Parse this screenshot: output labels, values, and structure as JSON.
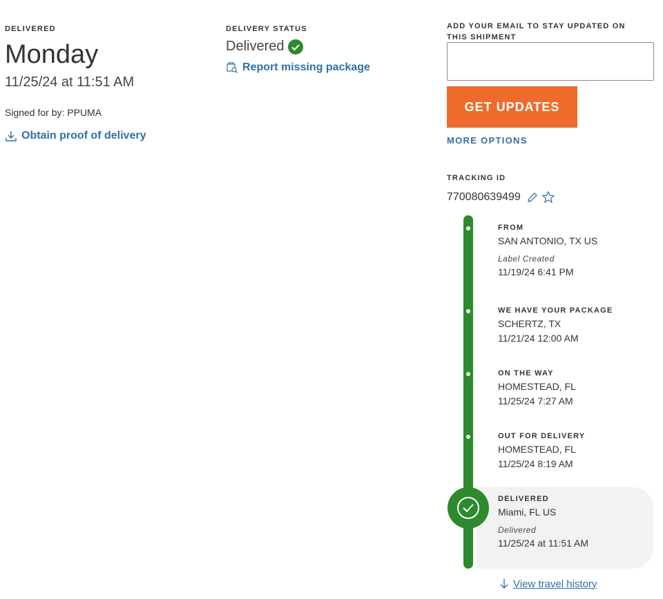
{
  "delivered_section": {
    "label": "DELIVERED",
    "day": "Monday",
    "datetime": "11/25/24 at 11:51 AM",
    "signed_for": "Signed for by: PPUMA",
    "proof_link": "Obtain proof of delivery"
  },
  "status_section": {
    "label": "DELIVERY STATUS",
    "status": "Delivered",
    "report_link": "Report missing package"
  },
  "email_section": {
    "label": "ADD YOUR EMAIL TO STAY UPDATED ON THIS SHIPMENT",
    "input_value": "",
    "button_label": "GET UPDATES",
    "more_options": "MORE OPTIONS"
  },
  "tracking": {
    "label": "TRACKING ID",
    "number": "770080639499"
  },
  "timeline": {
    "events": [
      {
        "title": "FROM",
        "line1": "SAN ANTONIO, TX US",
        "note": "Label Created",
        "line2": "11/19/24 6:41 PM"
      },
      {
        "title": "WE HAVE YOUR PACKAGE",
        "line1": "SCHERTZ, TX",
        "line2": "11/21/24 12:00 AM"
      },
      {
        "title": "ON THE WAY",
        "line1": "HOMESTEAD, FL",
        "line2": "11/25/24 7:27 AM"
      },
      {
        "title": "OUT FOR DELIVERY",
        "line1": "HOMESTEAD, FL",
        "line2": "11/25/24 8:19 AM"
      },
      {
        "title": "DELIVERED",
        "line1": "Miami, FL US",
        "note": "Delivered",
        "line2": "11/25/24 at 11:51 AM"
      }
    ],
    "view_history": "View travel history"
  },
  "colors": {
    "accent_green": "#2d8a2d",
    "link_blue": "#2f6fa8",
    "button_orange": "#ee6b2c"
  }
}
